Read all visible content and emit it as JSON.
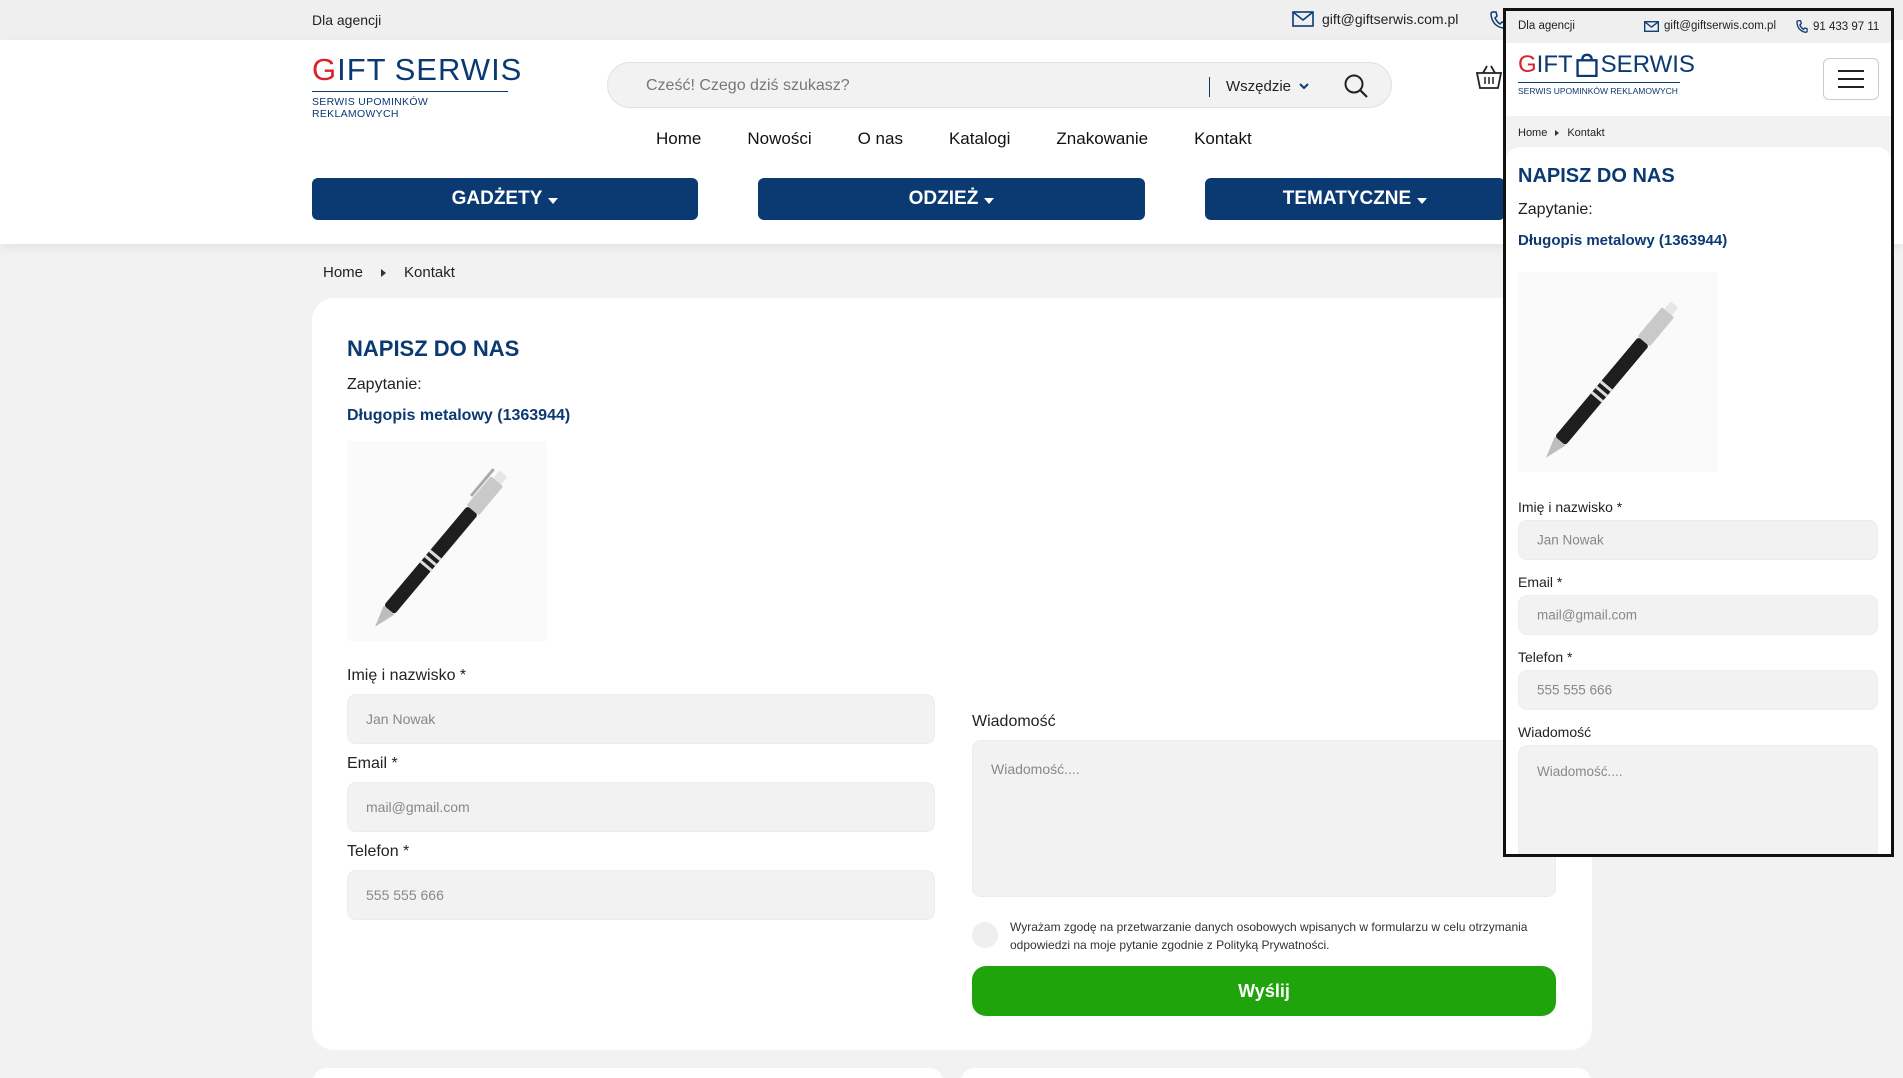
{
  "topbar": {
    "agency_label": "Dla agencji",
    "email": "gift@giftserwis.com.pl",
    "phone": "91 433 97 11"
  },
  "header": {
    "logo_brand_g": "G",
    "logo_brand_rest": "IFT",
    "logo_brand_second": "SERWIS",
    "logo_sub": "SERWIS UPOMINKÓW REKLAMOWYCH",
    "search_placeholder": "Cześć!  Czego dziś szukasz?",
    "search_scope": "Wszędzie",
    "nav": [
      "Home",
      "Nowości",
      "O nas",
      "Katalogi",
      "Znakowanie",
      "Kontakt"
    ],
    "categories": [
      "GADŻETY",
      "ODZIEŻ",
      "TEMATYCZNE"
    ]
  },
  "breadcrumb": [
    "Home",
    "Kontakt"
  ],
  "form": {
    "title": "NAPISZ DO NAS",
    "inquiry_label": "Zapytanie:",
    "product_name": "Długopis metalowy (1363944)",
    "name_label": "Imię i nazwisko *",
    "name_placeholder": "Jan Nowak",
    "email_label": "Email *",
    "email_placeholder": "mail@gmail.com",
    "phone_label": "Telefon *",
    "phone_placeholder": "555 555 666",
    "message_label": "Wiadomość",
    "message_placeholder": "Wiadomość....",
    "consent_text": "Wyrażam zgodę na przetwarzanie danych osobowych wpisanych w formularzu w celu otrzymania odpowiedzi na moje pytanie zgodnie z Polityką Prywatności.",
    "submit_label": "Wyślij"
  },
  "colors": {
    "brand_blue": "#0b3a73",
    "brand_red": "#d8232a",
    "submit_green": "#1fa50b"
  }
}
